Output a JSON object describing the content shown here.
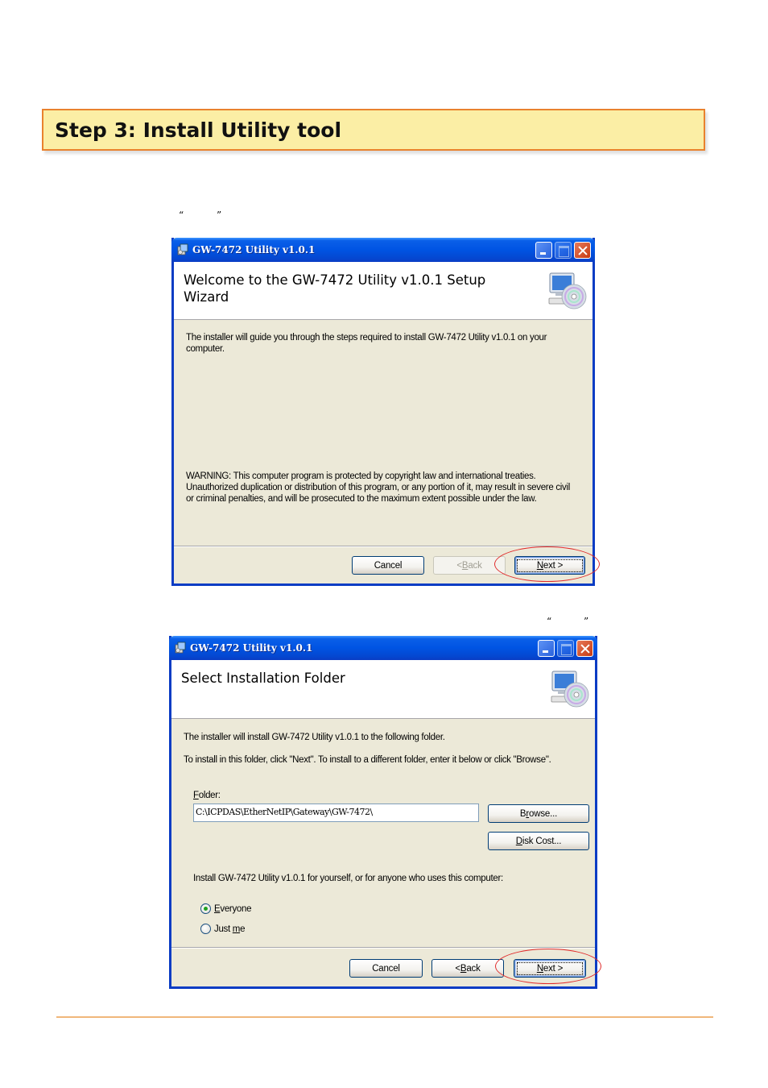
{
  "step": {
    "title": "Step 3:  Install Utility tool"
  },
  "quotes": {
    "open": "“",
    "close": "”"
  },
  "dialog1": {
    "window_title": "GW-7472 Utility v1.0.1",
    "banner_title_line1": "Welcome to the GW-7472 Utility v1.0.1 Setup",
    "banner_title_line2": "Wizard",
    "intro_line1": "The installer will guide you through the steps required to install GW-7472 Utility v1.0.1 on your",
    "intro_line2": "computer.",
    "warning_line1": "WARNING: This computer program is protected by copyright law and international treaties.",
    "warning_line2": "Unauthorized duplication or distribution of this program, or any portion of it, may result in severe civil",
    "warning_line3": "or criminal penalties, and will be prosecuted to the maximum extent possible under the law.",
    "cancel_label": "Cancel",
    "back_prefix": "< ",
    "back_hotkey": "B",
    "back_rest": "ack",
    "next_hotkey": "N",
    "next_rest": "ext >"
  },
  "dialog2": {
    "window_title": "GW-7472 Utility v1.0.1",
    "banner_title": "Select Installation Folder",
    "line1": "The installer will install GW-7472 Utility v1.0.1 to the following folder.",
    "line2": "To install in this folder, click \"Next\". To install to a different folder, enter it below or click \"Browse\".",
    "folder_label_hotkey": "F",
    "folder_label_rest": "older:",
    "folder_value": "C:\\ICPDAS\\EtherNetIP\\Gateway\\GW-7472\\",
    "browse_pre": "B",
    "browse_hotkey": "r",
    "browse_rest": "owse...",
    "disk_hotkey": "D",
    "disk_rest": "isk Cost...",
    "install_for": "Install GW-7472 Utility v1.0.1 for yourself, or for anyone who uses this computer:",
    "everyone_hotkey": "E",
    "everyone_rest": "veryone",
    "justme_pre": "Just ",
    "justme_hotkey": "m",
    "justme_rest": "e",
    "cancel_label": "Cancel",
    "back_prefix": "< ",
    "back_hotkey": "B",
    "back_rest": "ack",
    "next_hotkey": "N",
    "next_rest": "ext >"
  },
  "colors": {
    "step_fill": "#fbeea5",
    "step_border": "#e9822e",
    "xp_titlebar": "#0054e3",
    "dialog_face": "#ece9d8",
    "highlight_circle": "#e02a2a",
    "footer_rule": "#f0b77a"
  }
}
